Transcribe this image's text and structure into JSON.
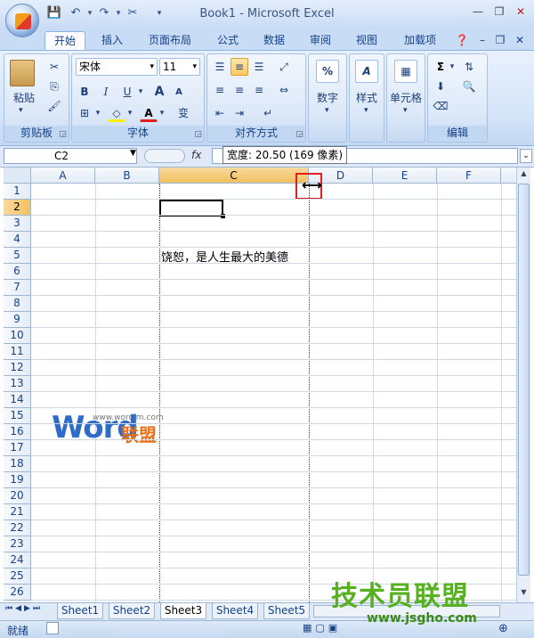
{
  "window": {
    "title": "Book1 - Microsoft Excel"
  },
  "tabs": [
    "开始",
    "插入",
    "页面布局",
    "公式",
    "数据",
    "审阅",
    "视图",
    "加载项"
  ],
  "ribbon": {
    "clipboard": {
      "paste_label": "粘贴",
      "group_label": "剪贴板"
    },
    "font": {
      "font_name": "宋体",
      "font_size": "11",
      "group_label": "字体",
      "bold": "B",
      "italic": "I",
      "underline": "U",
      "grow": "A",
      "shrink": "A",
      "wen": "变"
    },
    "alignment": {
      "group_label": "对齐方式"
    },
    "number": {
      "label": "数字",
      "symbol": "%"
    },
    "styles": {
      "label": "样式"
    },
    "cells": {
      "label": "单元格"
    },
    "editing": {
      "group_label": "编辑",
      "sigma": "Σ"
    }
  },
  "formula_bar": {
    "name_box": "C2",
    "fx": "fx",
    "tooltip": "宽度: 20.50 (169 像素)"
  },
  "columns": [
    "A",
    "B",
    "C",
    "D",
    "E",
    "F"
  ],
  "rows": [
    "1",
    "2",
    "3",
    "4",
    "5",
    "6",
    "7",
    "8",
    "9",
    "10",
    "11",
    "12",
    "13",
    "14",
    "15",
    "16",
    "17",
    "18",
    "19",
    "20",
    "21",
    "22",
    "23",
    "24",
    "25",
    "26"
  ],
  "cell_c5": "饶恕，是人生最大的美德",
  "watermark": {
    "small": "www.wordlm.com",
    "word": "Word",
    "lianmeng": "联盟"
  },
  "sheets": [
    "Sheet1",
    "Sheet2",
    "Sheet3",
    "Sheet4",
    "Sheet5"
  ],
  "status": {
    "ready": "就绪"
  },
  "corner_watermark": {
    "title": "技术员联盟",
    "url": "www.jsgho.com"
  }
}
